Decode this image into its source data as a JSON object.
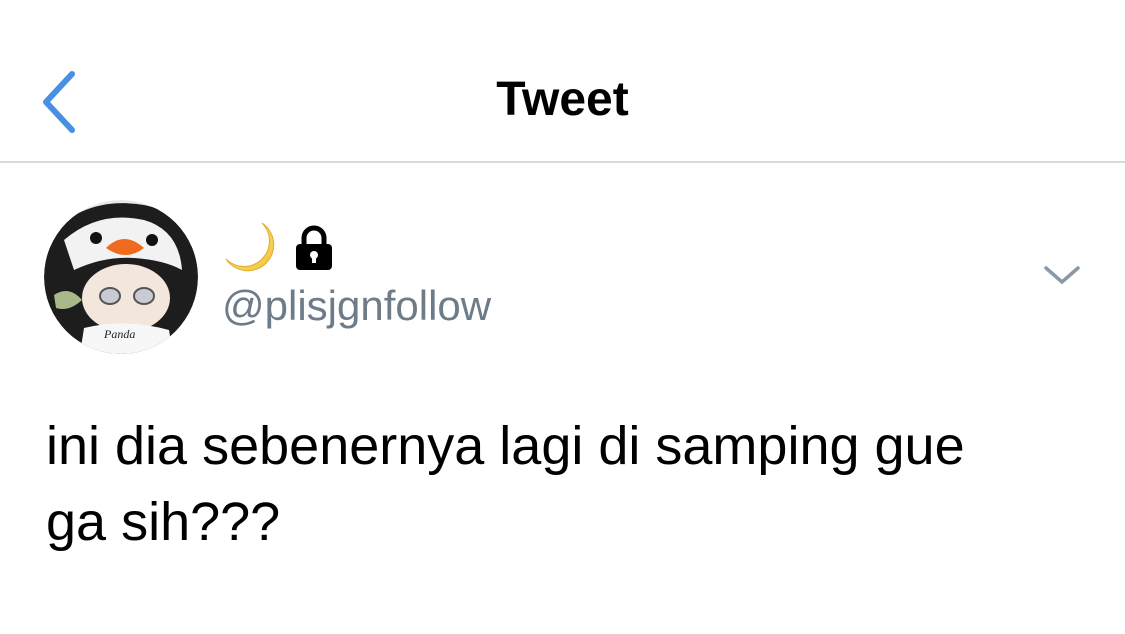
{
  "header": {
    "title": "Tweet",
    "back_icon": "chevron-left-icon",
    "accent_color": "#4a90e2"
  },
  "tweet": {
    "display_name_icons": [
      "crescent-moon-icon",
      "lock-icon"
    ],
    "handle": "@plisjgnfollow",
    "menu_icon": "chevron-down-icon",
    "avatar_label": "Panda",
    "text": "ini dia sebenernya lagi di samping gue\nga sih???"
  }
}
